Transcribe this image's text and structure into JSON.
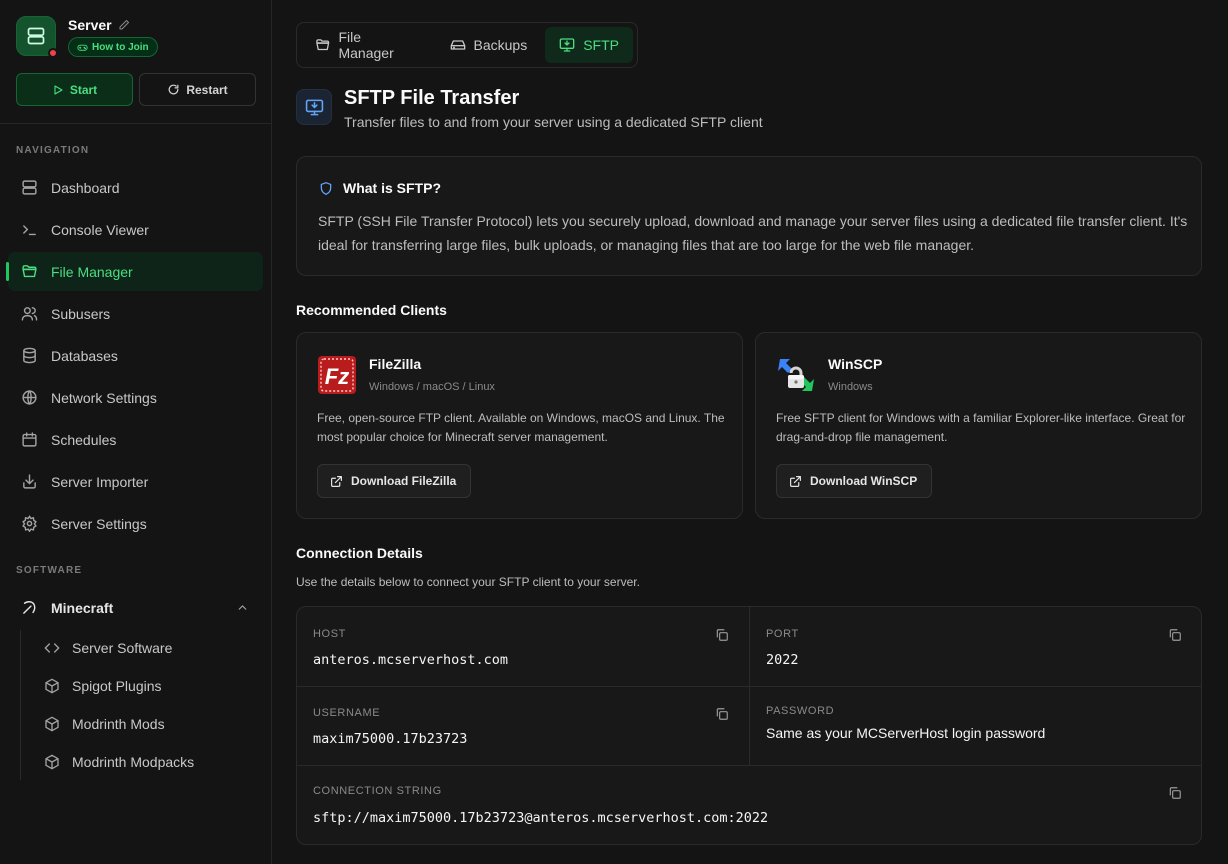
{
  "server": {
    "name": "Server",
    "join_label": "How to Join",
    "start_label": "Start",
    "restart_label": "Restart"
  },
  "nav": {
    "section_label": "NAVIGATION",
    "items": [
      {
        "label": "Dashboard",
        "icon": "server-icon"
      },
      {
        "label": "Console Viewer",
        "icon": "terminal-icon"
      },
      {
        "label": "File Manager",
        "icon": "folder-icon",
        "active": true
      },
      {
        "label": "Subusers",
        "icon": "users-icon"
      },
      {
        "label": "Databases",
        "icon": "database-icon"
      },
      {
        "label": "Network Settings",
        "icon": "globe-icon"
      },
      {
        "label": "Schedules",
        "icon": "calendar-icon"
      },
      {
        "label": "Server Importer",
        "icon": "import-icon"
      },
      {
        "label": "Server Settings",
        "icon": "gear-icon"
      }
    ]
  },
  "software": {
    "section_label": "SOFTWARE",
    "group_label": "Minecraft",
    "items": [
      {
        "label": "Server Software",
        "icon": "code-icon"
      },
      {
        "label": "Spigot Plugins",
        "icon": "cube-icon"
      },
      {
        "label": "Modrinth Mods",
        "icon": "cube-icon"
      },
      {
        "label": "Modrinth Modpacks",
        "icon": "cube-icon"
      }
    ]
  },
  "tabs": [
    {
      "label": "File Manager",
      "icon": "folder-icon"
    },
    {
      "label": "Backups",
      "icon": "hard-drive-icon"
    },
    {
      "label": "SFTP",
      "icon": "monitor-download-icon",
      "active": true
    }
  ],
  "page": {
    "title": "SFTP File Transfer",
    "subtitle": "Transfer files to and from your server using a dedicated SFTP client"
  },
  "info": {
    "title": "What is SFTP?",
    "text": "SFTP (SSH File Transfer Protocol) lets you securely upload, download and manage your server files using a dedicated file transfer client. It's ideal for transferring large files, bulk uploads, or managing files that are too large for the web file manager."
  },
  "clients": {
    "heading": "Recommended Clients",
    "list": [
      {
        "name": "FileZilla",
        "platforms": "Windows / macOS / Linux",
        "description": "Free, open-source FTP client. Available on Windows, macOS and Linux. The most popular choice for Minecraft server management.",
        "download_label": "Download FileZilla",
        "logo_text": "Fz"
      },
      {
        "name": "WinSCP",
        "platforms": "Windows",
        "description": "Free SFTP client for Windows with a familiar Explorer-like interface. Great for drag-and-drop file management.",
        "download_label": "Download WinSCP"
      }
    ]
  },
  "connection": {
    "heading": "Connection Details",
    "subtitle": "Use the details below to connect your SFTP client to your server.",
    "host_label": "HOST",
    "host": "anteros.mcserverhost.com",
    "port_label": "PORT",
    "port": "2022",
    "username_label": "USERNAME",
    "username": "maxim75000.17b23723",
    "password_label": "PASSWORD",
    "password": "Same as your MCServerHost login password",
    "conn_string_label": "CONNECTION STRING",
    "conn_string": "sftp://maxim75000.17b23723@anteros.mcserverhost.com:2022"
  },
  "colors": {
    "accent": "#4ade80",
    "background": "#141414",
    "card": "#181818",
    "status_offline": "#ef4444",
    "info_accent": "#60a5fa"
  }
}
